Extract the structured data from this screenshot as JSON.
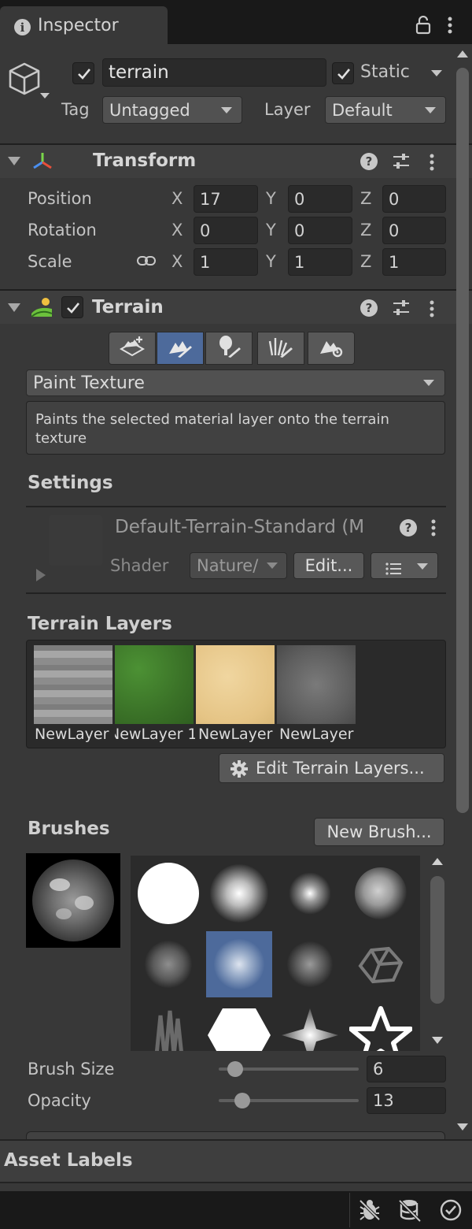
{
  "tab": {
    "title": "Inspector"
  },
  "object": {
    "name": "terrain",
    "active": true,
    "static_label": "Static",
    "static_checked": true,
    "tag_label": "Tag",
    "tag_value": "Untagged",
    "layer_label": "Layer",
    "layer_value": "Default"
  },
  "transform": {
    "title": "Transform",
    "position_label": "Position",
    "rotation_label": "Rotation",
    "scale_label": "Scale",
    "axis_x": "X",
    "axis_y": "Y",
    "axis_z": "Z",
    "position": {
      "x": "17",
      "y": "0",
      "z": "0"
    },
    "rotation": {
      "x": "0",
      "y": "0",
      "z": "0"
    },
    "scale": {
      "x": "1",
      "y": "1",
      "z": "1"
    }
  },
  "terrain": {
    "title": "Terrain",
    "enabled": true,
    "tools": [
      "create-neighbor-icon",
      "paint-terrain-icon",
      "paint-trees-icon",
      "paint-details-icon",
      "terrain-settings-icon"
    ],
    "active_tool_index": 1,
    "mode": "Paint Texture",
    "description": "Paints the selected material layer onto the terrain texture",
    "settings_title": "Settings",
    "material_name": "Default-Terrain-Standard (M",
    "shader_label": "Shader",
    "shader_value": "Nature/",
    "edit_label": "Edit...",
    "layers_title": "Terrain Layers",
    "layers": [
      {
        "name": "NewLayer",
        "color": "#9a9a9a"
      },
      {
        "name": "NewLayer 1",
        "color": "#3e7a2a"
      },
      {
        "name": "NewLayer",
        "color": "#e7c98f"
      },
      {
        "name": "NewLayer",
        "color": "#6b6b6b"
      }
    ],
    "edit_layers_label": "Edit Terrain Layers...",
    "brushes_title": "Brushes",
    "new_brush_label": "New Brush...",
    "selected_brush_index": 5,
    "brush_size_label": "Brush Size",
    "brush_size": "6",
    "brush_size_fraction": 0.12,
    "opacity_label": "Opacity",
    "opacity": "13",
    "opacity_fraction": 0.17
  },
  "footer": {
    "asset_labels": "Asset Labels"
  },
  "colors": {
    "accent": "#4d6a9b",
    "panel": "#383838",
    "field": "#2a2a2a"
  }
}
